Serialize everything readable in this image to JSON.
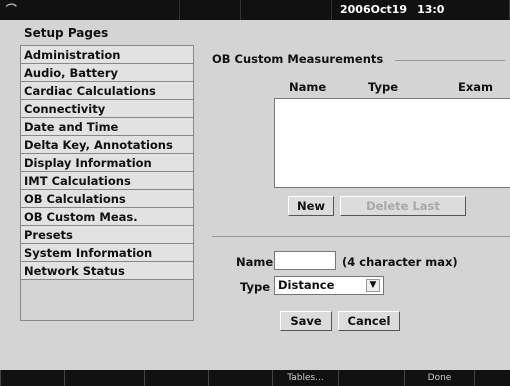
{
  "topbar": {
    "logo_glyph": "⌒",
    "date": "2006Oct19",
    "time": "13:0"
  },
  "setup_pages": {
    "title": "Setup Pages",
    "items": [
      {
        "label": "Administration"
      },
      {
        "label": "Audio, Battery"
      },
      {
        "label": "Cardiac Calculations"
      },
      {
        "label": "Connectivity"
      },
      {
        "label": "Date and Time"
      },
      {
        "label": "Delta Key, Annotations"
      },
      {
        "label": "Display Information"
      },
      {
        "label": "IMT Calculations"
      },
      {
        "label": "OB Calculations"
      },
      {
        "label": "OB Custom Meas."
      },
      {
        "label": "Presets"
      },
      {
        "label": "System Information"
      },
      {
        "label": "Network Status"
      }
    ]
  },
  "ob_custom": {
    "title": "OB Custom Measurements",
    "columns": [
      "Name",
      "Type",
      "Exam"
    ],
    "new_label": "New",
    "delete_last_label": "Delete Last",
    "name_label": "Name",
    "name_value": "",
    "name_hint": "(4 character max)",
    "type_label": "Type",
    "type_value": "Distance",
    "save_label": "Save",
    "cancel_label": "Cancel"
  },
  "softkeys": {
    "tables_label": "Tables...",
    "done_label": "Done"
  }
}
